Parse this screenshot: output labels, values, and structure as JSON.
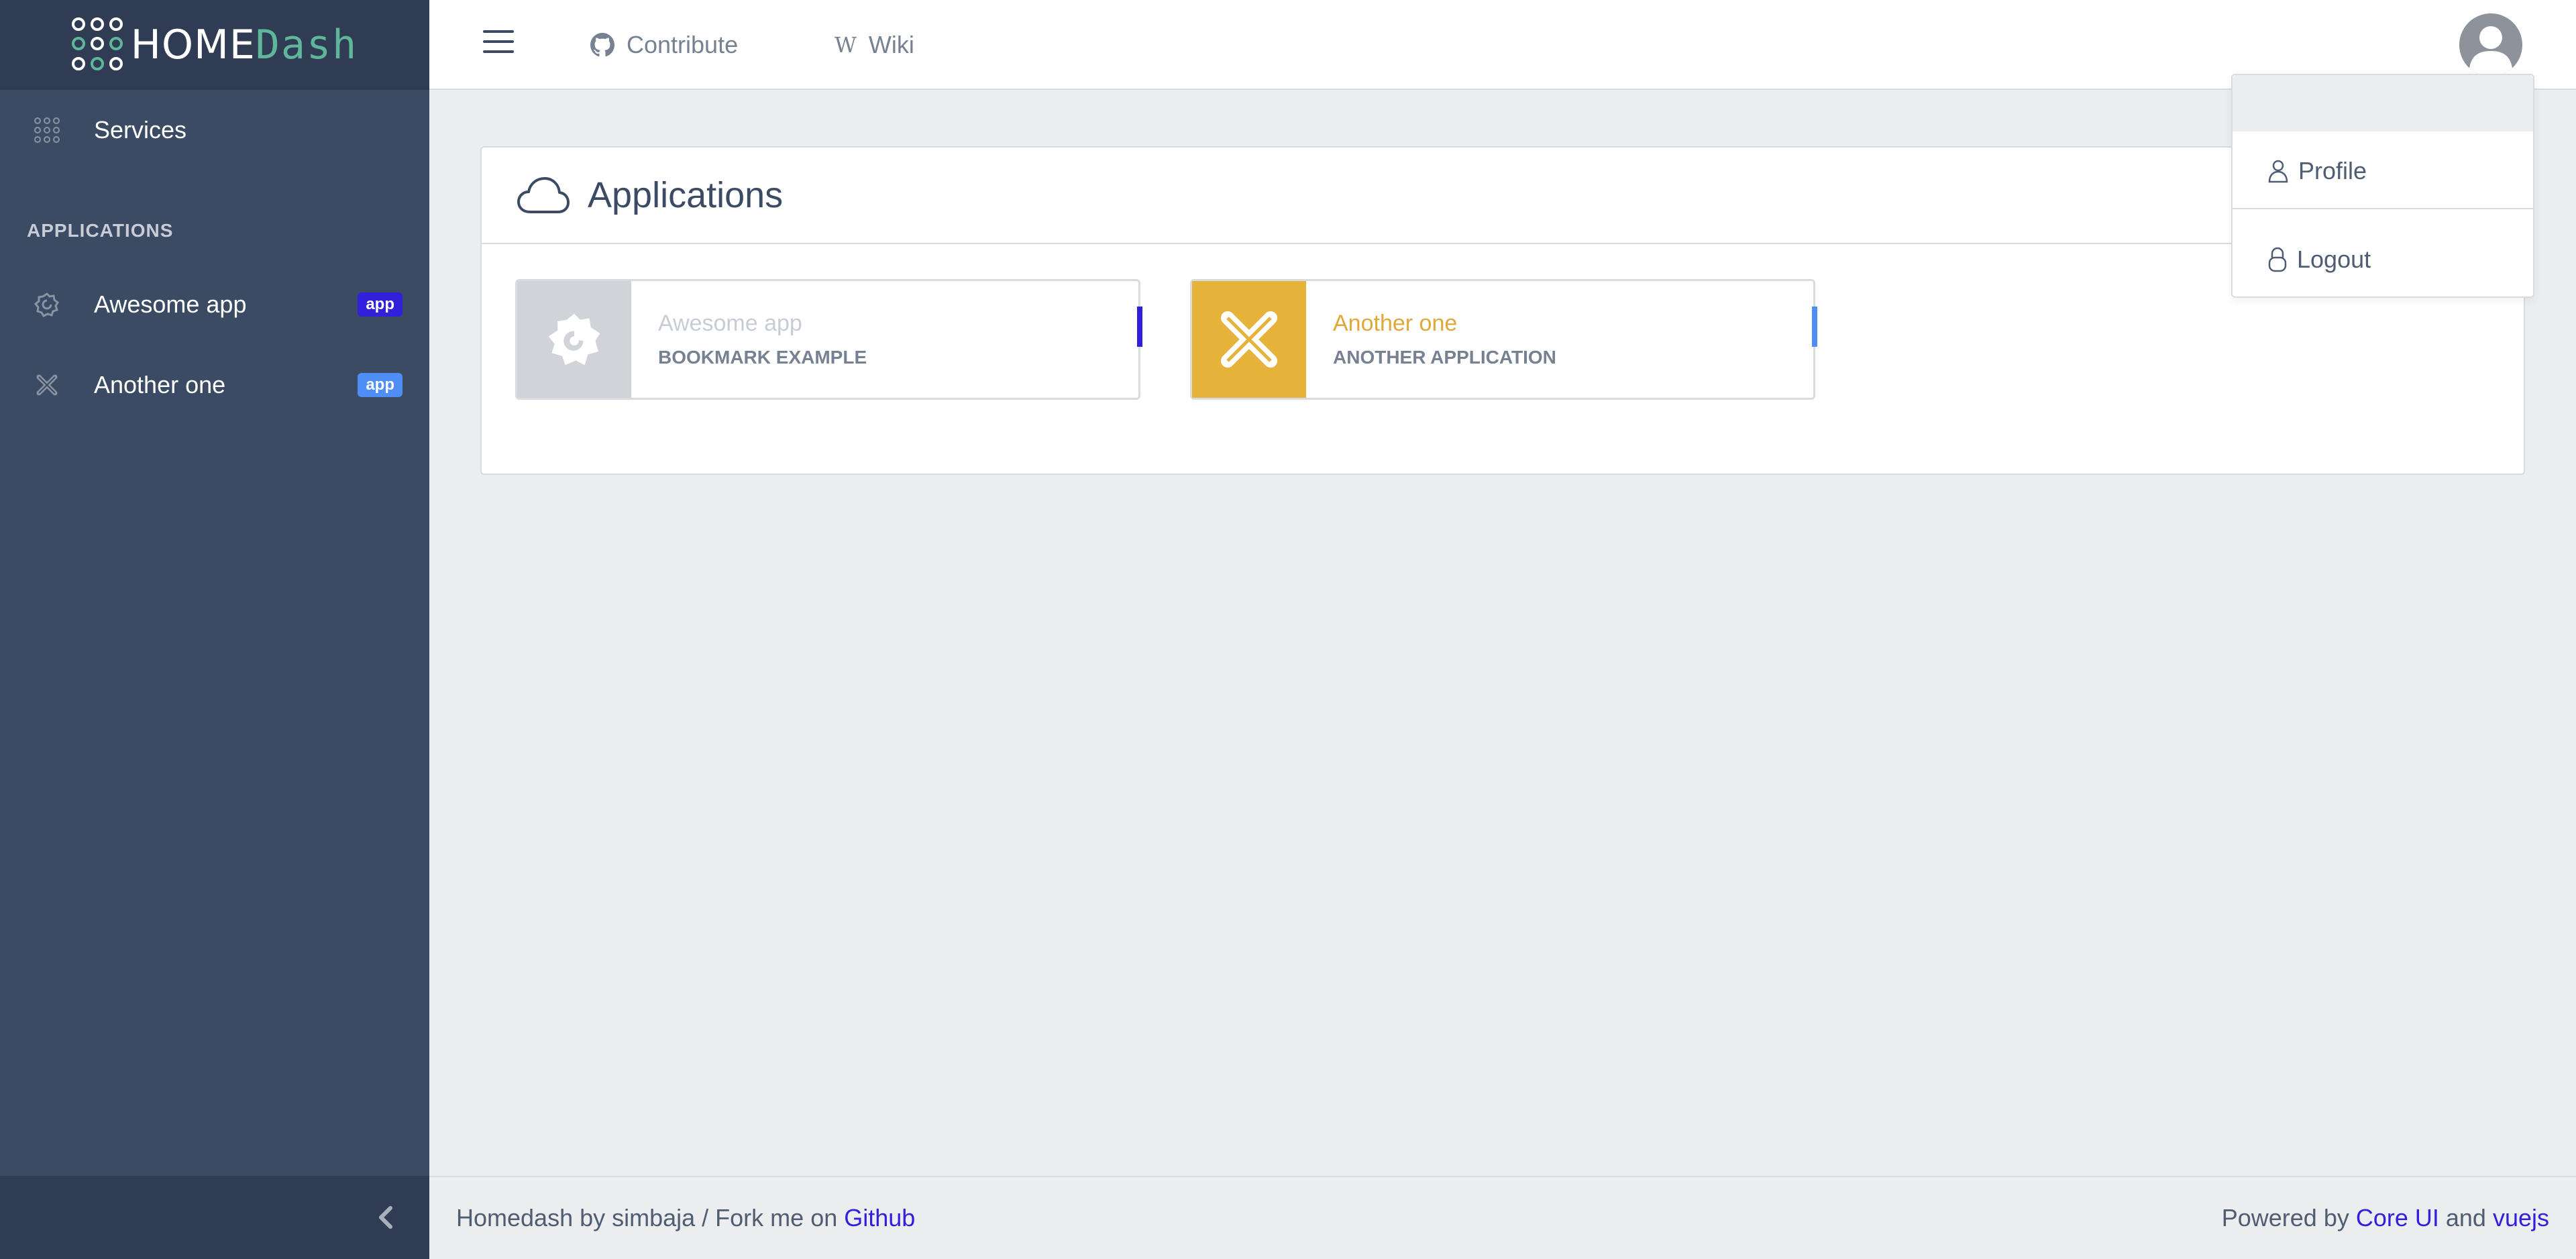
{
  "brand": {
    "home": "HOME",
    "dash": "Dash"
  },
  "sidebar": {
    "items": [
      {
        "label": "Services",
        "icon": "grid-dots-icon"
      }
    ],
    "section_title": "APPLICATIONS",
    "apps": [
      {
        "label": "Awesome app",
        "badge": "app",
        "badge_color": "#321fdb",
        "icon": "grafana-icon"
      },
      {
        "label": "Another one",
        "badge": "app",
        "badge_color": "#4f8ef7",
        "icon": "proxmox-icon"
      }
    ],
    "collapse_icon": "chevron-left-icon"
  },
  "header": {
    "nav": [
      {
        "label": "Contribute",
        "icon": "github-icon"
      },
      {
        "label": "Wiki",
        "icon": "wikipedia-icon"
      }
    ],
    "menu_icon": "hamburger-icon",
    "avatar_icon": "user-avatar-icon"
  },
  "card": {
    "title": "Applications",
    "icon": "cloud-icon",
    "apps": [
      {
        "name": "Awesome app",
        "subtitle": "BOOKMARK EXAMPLE",
        "name_color": "#c8ccd6",
        "thumb_color": "#d0d3d8",
        "marker_color": "#321fdb"
      },
      {
        "name": "Another one",
        "subtitle": "ANOTHER APPLICATION",
        "name_color": "#e0a838",
        "thumb_color": "#e5b23a",
        "marker_color": "#4f8ef7"
      }
    ]
  },
  "dropdown": {
    "items": [
      {
        "label": "Profile",
        "icon": "user-icon"
      },
      {
        "label": "Logout",
        "icon": "lock-icon"
      }
    ]
  },
  "footer": {
    "left_text": "Homedash by simbaja / Fork me on ",
    "left_link": "Github",
    "right_text": "Powered by ",
    "right_link1": "Core UI",
    "right_and": " and ",
    "right_link2": "vuejs"
  },
  "colors": {
    "sidebar_bg": "#3c4b64",
    "sidebar_dark": "#303c54",
    "accent": "#321fdb",
    "brand_green": "#5fb69b"
  }
}
